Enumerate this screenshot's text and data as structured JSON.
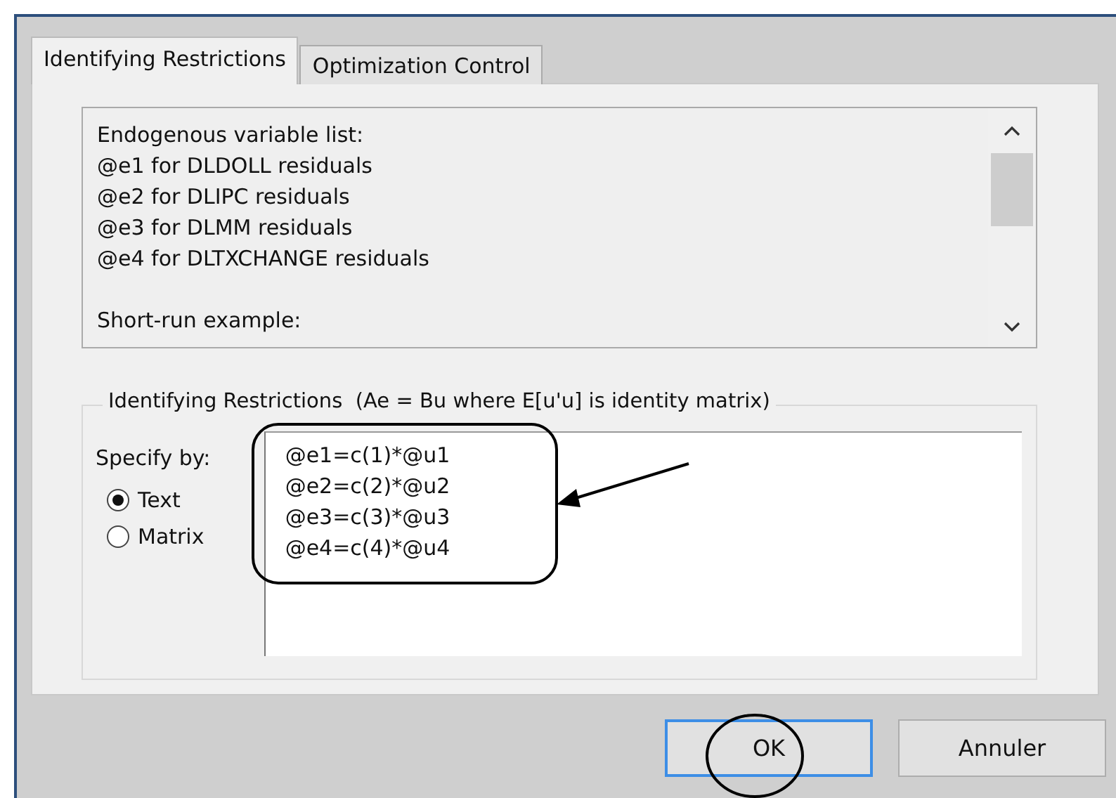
{
  "tabs": [
    {
      "label": "Identifying Restrictions",
      "selected": true
    },
    {
      "label": "Optimization Control",
      "selected": false
    }
  ],
  "info_box": {
    "lines": [
      "Endogenous variable list:",
      "@e1 for DLDOLL residuals",
      "@e2 for DLIPC residuals",
      "@e3 for DLMM residuals",
      "@e4 for DLTXCHANGE residuals"
    ],
    "example_label": "Short-run example:"
  },
  "group": {
    "title": "Identifying Restrictions  (Ae = Bu where E[u'u] is identity matrix)",
    "specify_label": "Specify by:",
    "options": [
      {
        "label": "Text",
        "selected": true
      },
      {
        "label": "Matrix",
        "selected": false
      }
    ],
    "text_lines": [
      "@e1=c(1)*@u1",
      "@e2=c(2)*@u2",
      "@e3=c(3)*@u3",
      "@e4=c(4)*@u4"
    ]
  },
  "buttons": [
    {
      "label": "OK",
      "default": true
    },
    {
      "label": "Annuler",
      "default": false
    }
  ]
}
